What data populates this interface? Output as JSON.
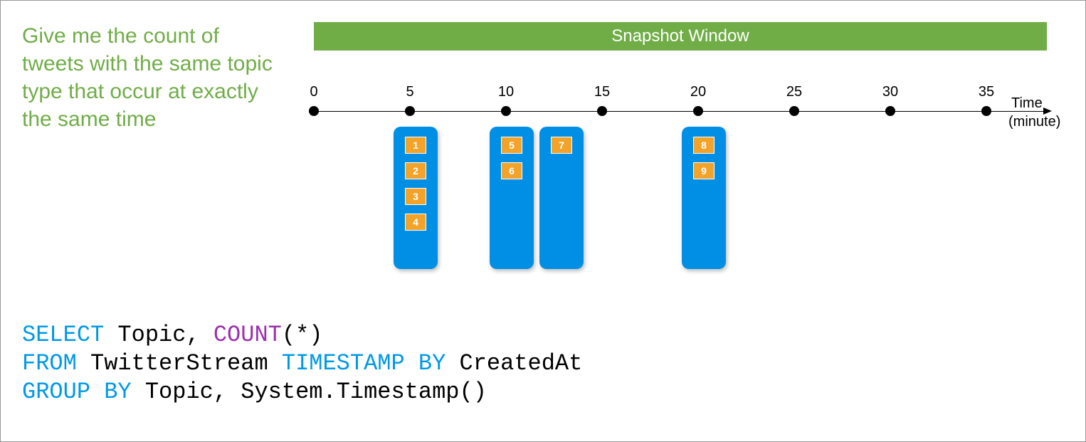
{
  "description_text": "Give me the count of tweets with the same topic type that occur at exactly the same time",
  "header_bar": "Snapshot Window",
  "axis": {
    "title": "Time",
    "unit": "(minute)",
    "ticks": [
      "0",
      "5",
      "10",
      "15",
      "20",
      "25",
      "30",
      "35"
    ]
  },
  "windows": [
    {
      "pos": 1,
      "offset": 0,
      "events": [
        "1",
        "2",
        "3",
        "4"
      ]
    },
    {
      "pos": 2,
      "offset": 0,
      "events": [
        "5",
        "6"
      ]
    },
    {
      "pos": 2,
      "offset": 70,
      "events": [
        "7"
      ]
    },
    {
      "pos": 4,
      "offset": 0,
      "events": [
        "8",
        "9"
      ]
    }
  ],
  "sql": {
    "select": "SELECT",
    "topic": "Topic,",
    "count": "COUNT",
    "paren": "(*)",
    "from": "FROM",
    "stream": "TwitterStream",
    "timestamp_by": "TIMESTAMP BY",
    "created": "CreatedAt",
    "group_by": "GROUP BY",
    "group_cols": "Topic, System.Timestamp()"
  }
}
